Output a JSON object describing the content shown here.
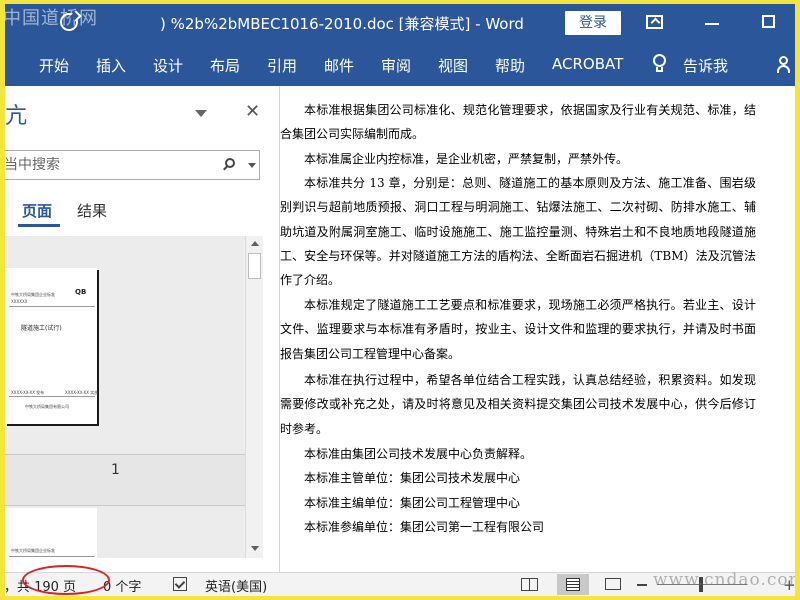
{
  "watermark_top": "中国道桥网",
  "watermark_bottom": "www.cndao.com",
  "titlebar": {
    "title": ") %2b%2bMBEC1016-2010.doc [兼容模式] - Word",
    "login_label": "登录"
  },
  "ribbon": {
    "tabs": [
      "开始",
      "插入",
      "设计",
      "布局",
      "引用",
      "邮件",
      "审阅",
      "视图",
      "帮助",
      "ACROBAT"
    ],
    "tell_me": "告诉我"
  },
  "navpane": {
    "title": "亢",
    "search": {
      "placeholder": "当中搜索"
    },
    "tabs": {
      "pages": "页面",
      "results": "结果"
    },
    "thumbnail": {
      "header_left": "中铁大桥局集团企业标准",
      "header_right": "QB",
      "code": "XXXXXX",
      "doc_title": "隧道施工(试行)",
      "footer_left": "XXXX-XX-XX 发布",
      "footer_right": "XXXX-XX-XX 实施",
      "publisher": "中铁大桥局集团有限公司"
    },
    "page_number": "1",
    "thumbnail2_header": "中铁大桥局集团企业标准"
  },
  "document": {
    "paragraphs": [
      "本标准根据集团公司标准化、规范化管理要求，依据国家及行业有关规范、标准，结合集团公司实际编制而成。",
      "本标准属企业内控标准，是企业机密，严禁复制，严禁外传。",
      "本标准共分 13 章，分别是：总则、隧道施工的基本原则及方法、施工准备、围岩级别判识与超前地质预报、洞口工程与明洞施工、钻爆法施工、二次衬砌、防排水施工、辅助坑道及附属洞室施工、临时设施施工、施工监控量测、特殊岩土和不良地质地段隧道施工、安全与环保等。并对隧道施工方法的盾构法、全断面岩石掘进机（TBM）法及沉管法作了介绍。",
      "本标准规定了隧道施工工艺要点和标准要求，现场施工必须严格执行。若业主、设计文件、监理要求与本标准有矛盾时，按业主、设计文件和监理的要求执行，并请及时书面报告集团公司工程管理中心备案。",
      "本标准在执行过程中，希望各单位结合工程实践，认真总结经验，积累资料。如发现需要修改或补充之处，请及时将意见及相关资料提交集团公司技术发展中心，供今后修订时参考。",
      "本标准由集团公司技术发展中心负责解释。",
      "本标准主管单位：集团公司技术发展中心",
      "本标准主编单位：集团公司工程管理中心",
      "本标准参编单位：集团公司第一工程有限公司"
    ]
  },
  "statusbar": {
    "pages": "，共 190 页",
    "words": "0 个字",
    "language": "英语(美国)"
  },
  "colors": {
    "accent": "#2b579a",
    "border": "#f4e53c",
    "highlight": "#e02020"
  }
}
